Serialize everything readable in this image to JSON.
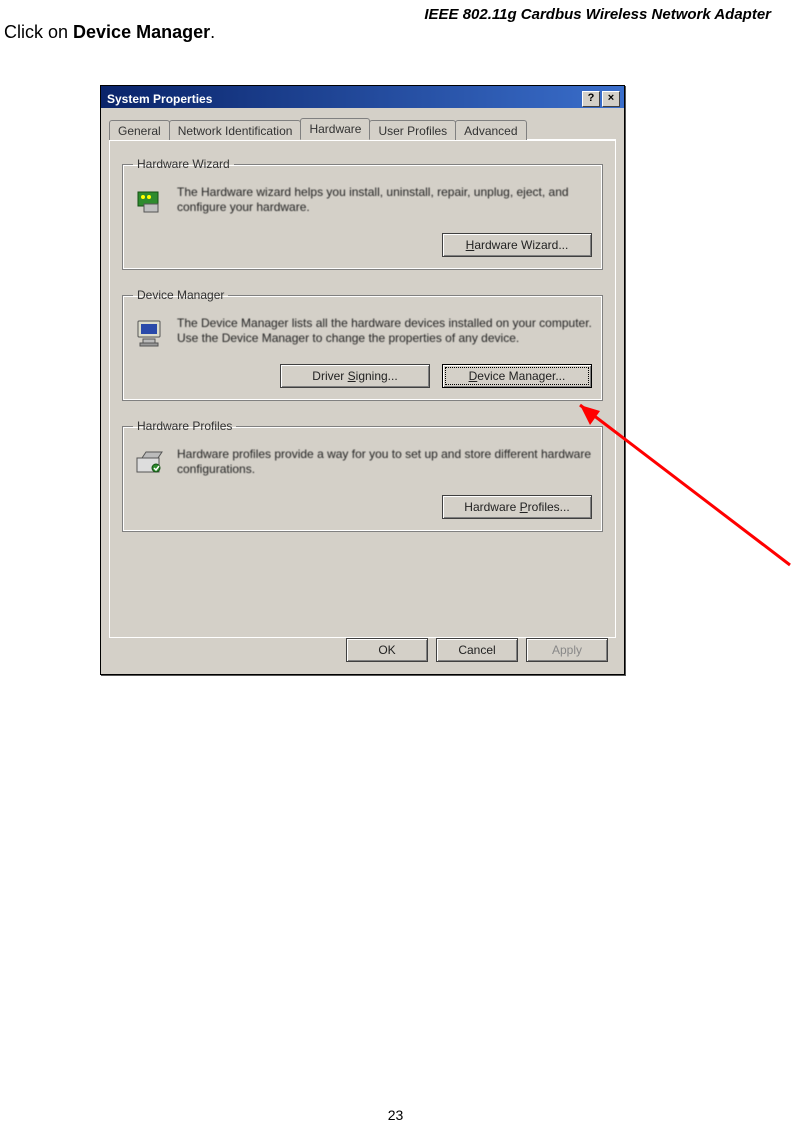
{
  "doc": {
    "header": "IEEE 802.11g Cardbus Wireless Network Adapter",
    "instruction_prefix": "Click on ",
    "instruction_bold": "Device Manager",
    "instruction_suffix": ".",
    "page_number": "23"
  },
  "dialog": {
    "title": "System Properties",
    "help_btn": "?",
    "close_btn": "×",
    "tabs": {
      "general": "General",
      "network_id": "Network Identification",
      "hardware": "Hardware",
      "user_profiles": "User Profiles",
      "advanced": "Advanced"
    },
    "groups": {
      "hw_wizard": {
        "legend": "Hardware Wizard",
        "text": "The Hardware wizard helps you install, uninstall, repair, unplug, eject, and configure your hardware.",
        "button": "Hardware Wizard..."
      },
      "device_manager": {
        "legend": "Device Manager",
        "text": "The Device Manager lists all the hardware devices installed on your computer. Use the Device Manager to change the properties of any device.",
        "driver_signing_btn": "Driver Signing...",
        "device_manager_btn": "Device Manager..."
      },
      "hw_profiles": {
        "legend": "Hardware Profiles",
        "text": "Hardware profiles provide a way for you to set up and store different hardware configurations.",
        "button": "Hardware Profiles..."
      }
    },
    "buttons": {
      "ok": "OK",
      "cancel": "Cancel",
      "apply": "Apply"
    }
  }
}
